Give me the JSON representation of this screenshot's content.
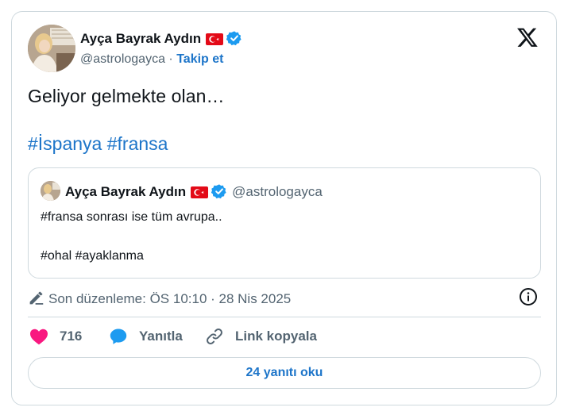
{
  "author": {
    "name": "Ayça Bayrak Aydın",
    "handle": "@astrologayca",
    "separator": "·",
    "follow_label": "Takip et"
  },
  "tweet": {
    "text": "Geliyor gelmekte olan…",
    "hashtags": [
      "#İspanya",
      "#fransa"
    ]
  },
  "quoted_tweet": {
    "name": "Ayça Bayrak Aydın",
    "handle": "@astrologayca",
    "line1": "#fransa sonrası ise tüm avrupa..",
    "line2": "#ohal #ayaklanma"
  },
  "edit_info": {
    "text": "Son düzenleme: ÖS 10:10 · 28 Nis 2025"
  },
  "actions": {
    "like_count": "716",
    "reply_label": "Yanıtla",
    "copy_link_label": "Link kopyala"
  },
  "read_replies_label": "24 yanıtı oku",
  "colors": {
    "link": "#1d75c9",
    "like": "#f91880",
    "verified": "#1d9bf0",
    "reply_icon": "#1d9bf0",
    "border": "#cfd9de",
    "muted": "#536471"
  },
  "icons": [
    "x-logo-icon",
    "verified-badge-icon",
    "turkey-flag-icon",
    "pencil-icon",
    "info-icon",
    "heart-icon",
    "reply-bubble-icon",
    "link-icon"
  ]
}
